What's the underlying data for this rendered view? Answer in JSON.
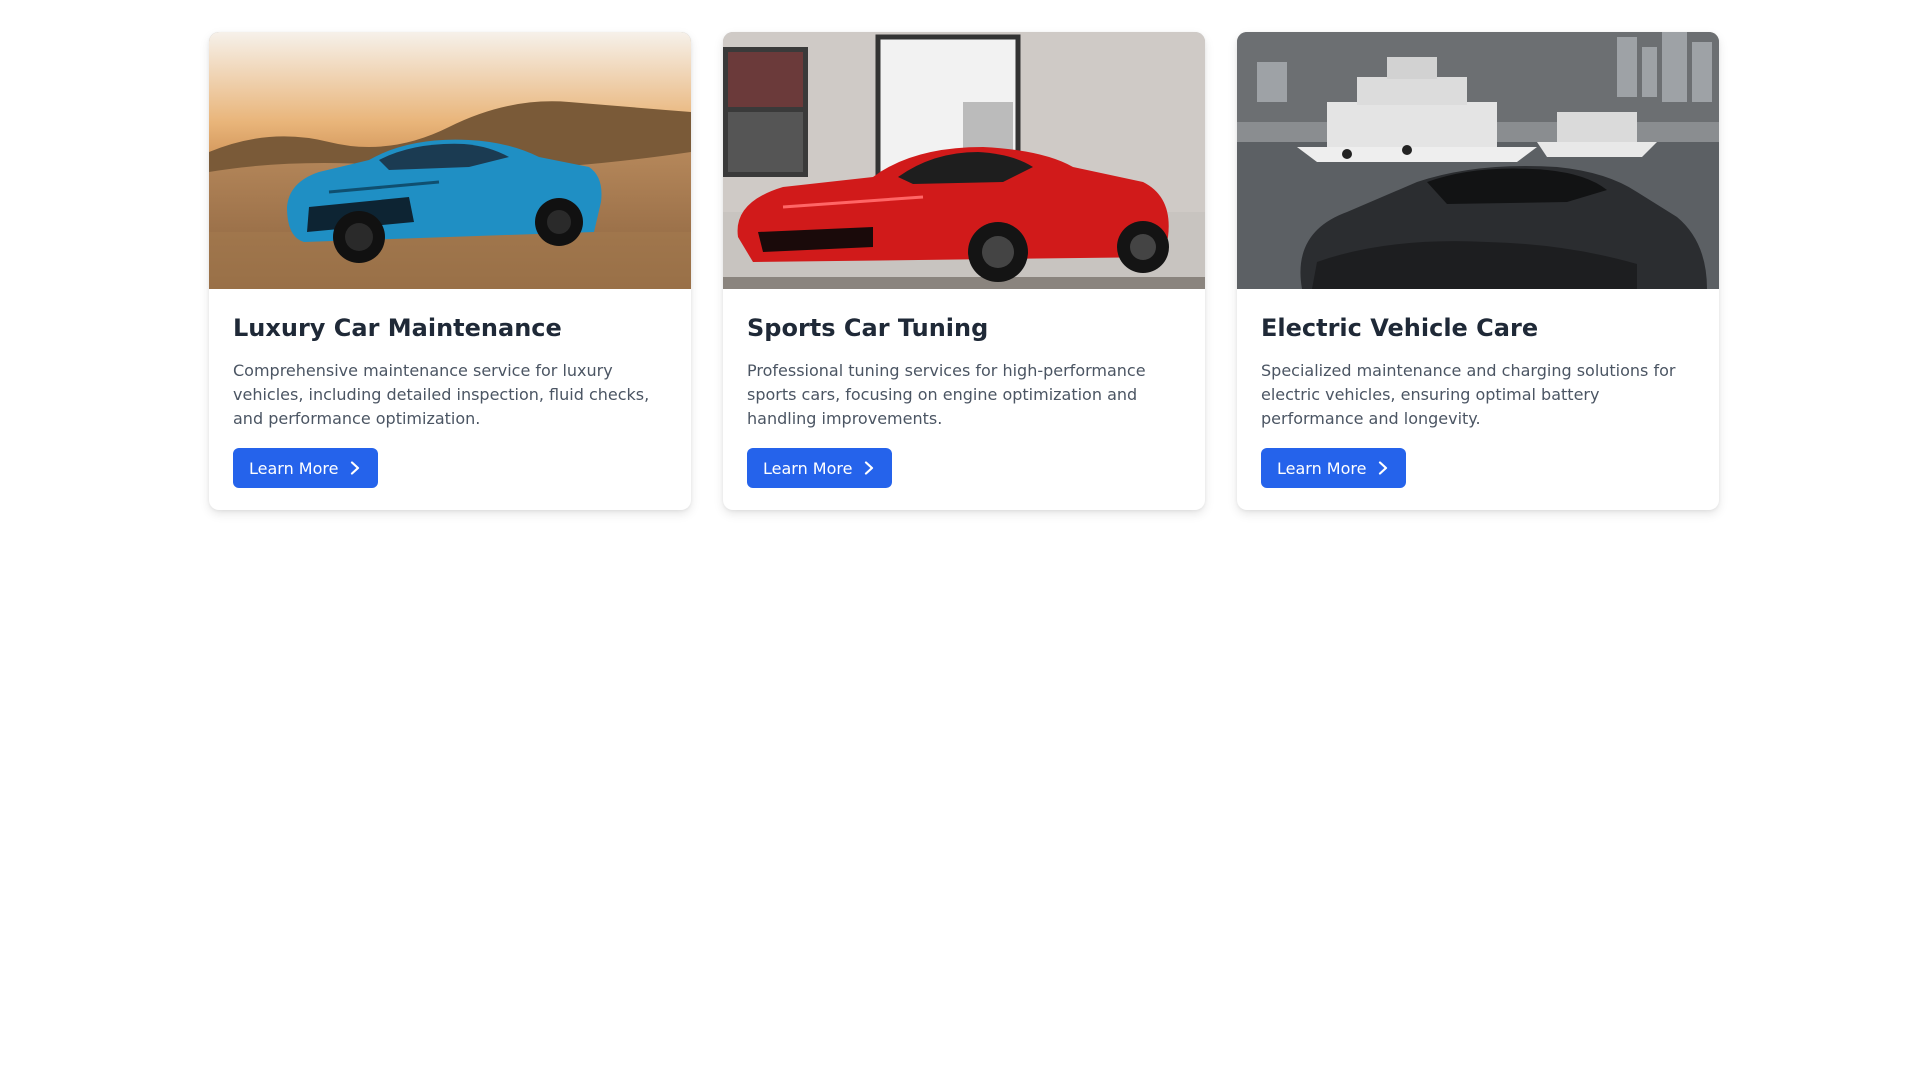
{
  "cards": [
    {
      "image_name": "blue-sports-car-desert-photo",
      "title": "Luxury Car Maintenance",
      "description": "Comprehensive maintenance service for luxury vehicles, including detailed inspection, fluid checks, and performance optimization.",
      "button_label": "Learn More",
      "button_icon": "chevron-right-icon"
    },
    {
      "image_name": "red-supercar-showroom-photo",
      "title": "Sports Car Tuning",
      "description": "Professional tuning services for high-performance sports cars, focusing on engine optimization and handling improvements.",
      "button_label": "Learn More",
      "button_icon": "chevron-right-icon"
    },
    {
      "image_name": "dark-coupe-harbor-yachts-photo",
      "title": "Electric Vehicle Care",
      "description": "Specialized maintenance and charging solutions for electric vehicles, ensuring optimal battery performance and longevity.",
      "button_label": "Learn More",
      "button_icon": "chevron-right-icon"
    }
  ],
  "colors": {
    "button_bg": "#2563eb",
    "title_text": "#1f2937",
    "body_text": "#4b5563"
  }
}
